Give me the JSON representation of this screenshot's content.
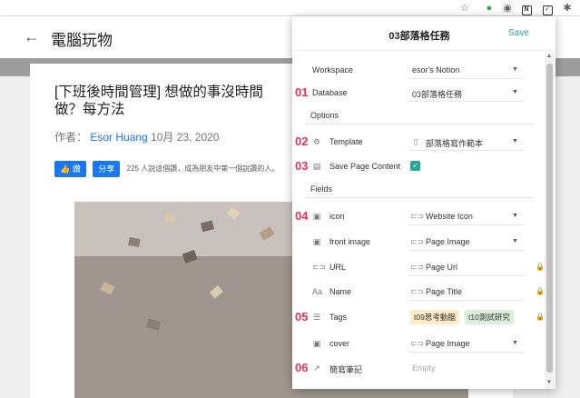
{
  "browser": {
    "star_icon": "star-icon",
    "ext_icons": [
      "evernote-icon",
      "search-ext-icon",
      "n-ext-icon",
      "save-to-notion-icon",
      "puzzle-icon"
    ]
  },
  "page": {
    "site_title": "電腦玩物",
    "post_title": "[下班後時間管理] 想做的事沒時間做？每方法",
    "byline_prefix": "作者：",
    "author": "Esor Huang",
    "date": "10月 23, 2020",
    "fb_like": "讚",
    "fb_share": "分享",
    "fb_text": "225 人說這個讚，成為朋友中第一個說讚的人。"
  },
  "popup": {
    "title": "03部落格任務",
    "save_label": "Save",
    "workspace": {
      "label": "Workspace",
      "value": "esor's Notion"
    },
    "database": {
      "label": "Database",
      "value": "03部落格任務",
      "badge": "01"
    },
    "options_heading": "Options",
    "template": {
      "label": "Template",
      "value": "部落格寫作範本",
      "badge": "02"
    },
    "save_content": {
      "label": "Save Page Content",
      "checked": true,
      "badge": "03"
    },
    "fields_heading": "Fields",
    "fields": [
      {
        "name": "icon",
        "value": "Website Icon",
        "badge": "04",
        "dropdown": true,
        "locked": false
      },
      {
        "name": "front image",
        "value": "Page Image",
        "badge": "",
        "dropdown": true,
        "locked": false
      },
      {
        "name": "URL",
        "value": "Page Url",
        "badge": "",
        "dropdown": false,
        "locked": true
      },
      {
        "name": "Name",
        "value": "Page Title",
        "badge": "",
        "dropdown": false,
        "locked": true
      },
      {
        "name": "Tags",
        "tags": [
          "t09思考動腦",
          "t10測試研究"
        ],
        "badge": "05",
        "locked": true
      },
      {
        "name": "cover",
        "value": "Page Image",
        "badge": "",
        "dropdown": true,
        "locked": false
      },
      {
        "name": "簡寫筆記",
        "value": "Empty",
        "badge": "06",
        "placeholder": true
      }
    ]
  }
}
